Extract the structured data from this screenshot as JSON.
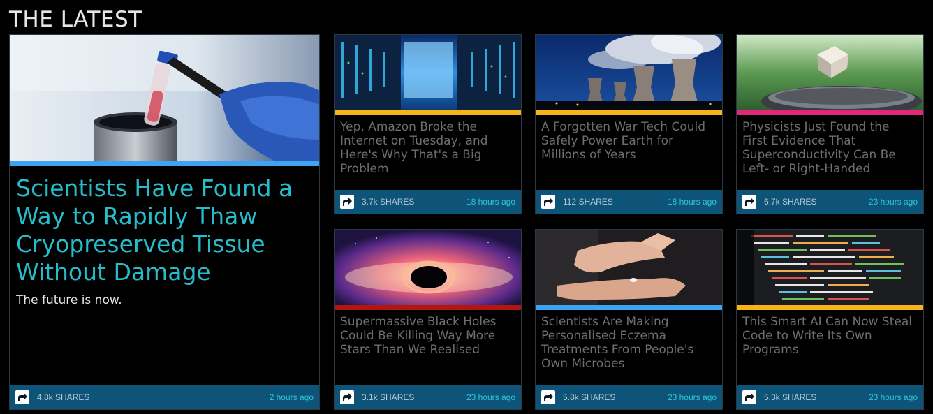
{
  "section": {
    "title": "THE LATEST"
  },
  "colors": {
    "footer": "#0d5478",
    "feature_title": "#27bcc9",
    "time": "#2cc6d6",
    "bar_blue": "#3ea3f0",
    "bar_yellow": "#f4b41a",
    "bar_pink": "#e2267a",
    "bar_red": "#b3150f"
  },
  "feature": {
    "title": "Scientists Have Found a Way to Rapidly Thaw Cryopreserved Tissue Without Damage",
    "subtitle": "The future is now.",
    "shares": "4.8k SHARES",
    "time": "2 hours ago",
    "image_icon": "lab-tube-tweezers-image"
  },
  "articles": [
    {
      "title": "Yep, Amazon Broke the Internet on Tuesday, and Here's Why That's a Big Problem",
      "shares": "3.7k SHARES",
      "time": "18 hours ago",
      "image_icon": "server-room-image"
    },
    {
      "title": "A Forgotten War Tech Could Safely Power Earth for Millions of Years",
      "shares": "112 SHARES",
      "time": "18 hours ago",
      "image_icon": "cooling-towers-image"
    },
    {
      "title": "Physicists Just Found the First Evidence That Superconductivity Can Be Left- or Right-Handed",
      "shares": "6.7k SHARES",
      "time": "23 hours ago",
      "image_icon": "levitating-cube-image"
    },
    {
      "title": "Supermassive Black Holes Could Be Killing Way More Stars Than We Realised",
      "shares": "3.1k SHARES",
      "time": "23 hours ago",
      "image_icon": "black-hole-image"
    },
    {
      "title": "Scientists Are Making Personalised Eczema Treatments From People's Own Microbes",
      "shares": "5.8k SHARES",
      "time": "23 hours ago",
      "image_icon": "skin-cream-image"
    },
    {
      "title": "This Smart AI Can Now Steal Code to Write Its Own Programs",
      "shares": "5.3k SHARES",
      "time": "23 hours ago",
      "image_icon": "code-screen-image"
    }
  ]
}
